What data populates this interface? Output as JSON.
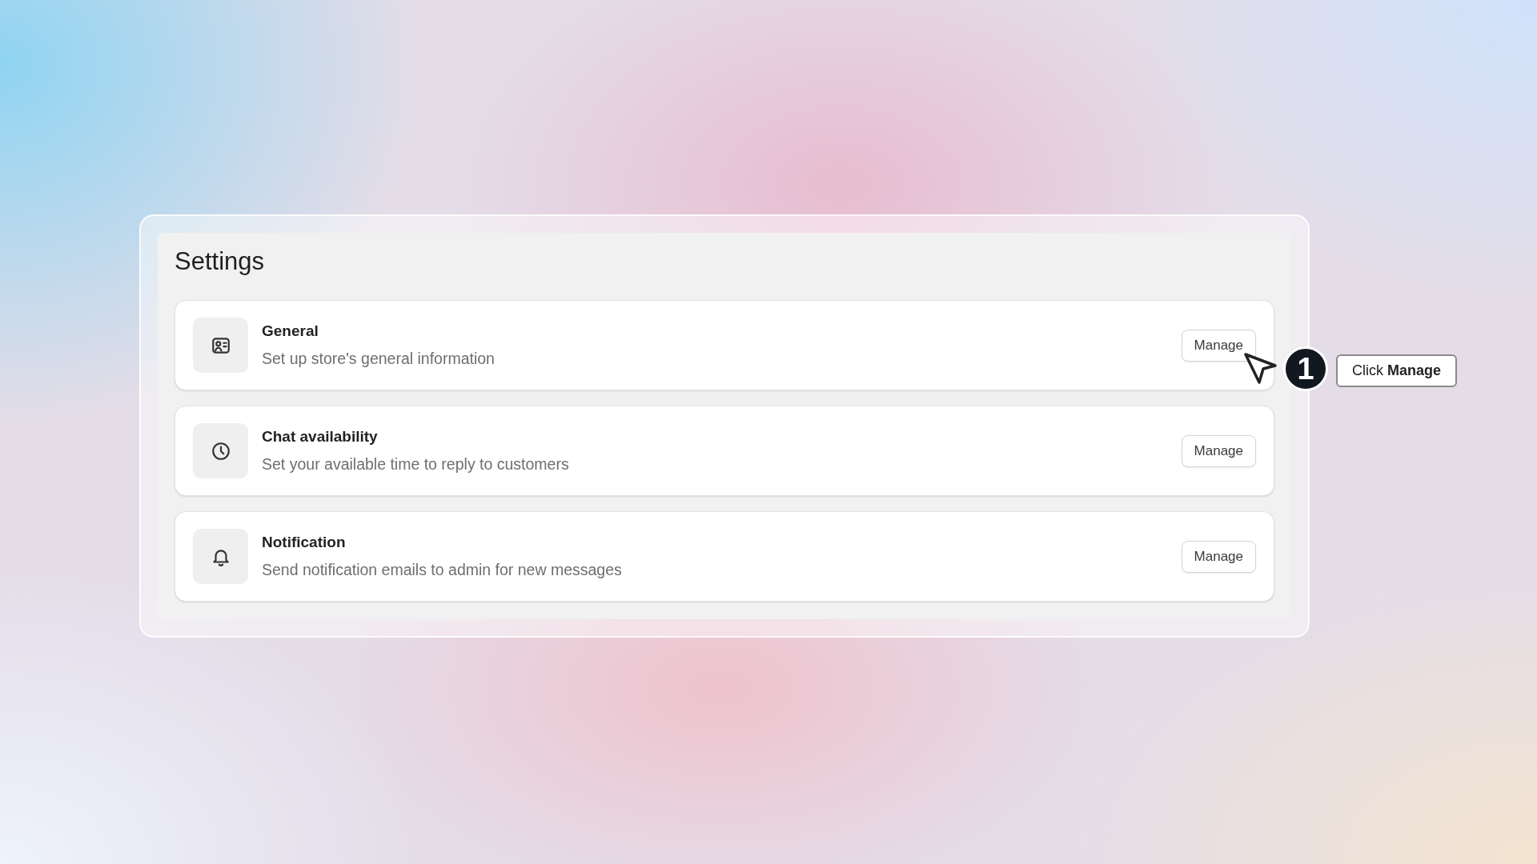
{
  "title": "Settings",
  "items": [
    {
      "kind": "id-card",
      "name": "General",
      "description": "Set up store's general information",
      "button": "Manage"
    },
    {
      "kind": "clock",
      "name": "Chat availability",
      "description": "Set your available time to reply to customers",
      "button": "Manage"
    },
    {
      "kind": "bell",
      "name": "Notification",
      "description": "Send notification emails to admin for new messages",
      "button": "Manage"
    }
  ],
  "callout": {
    "step": "1",
    "text": "Click **Manage**"
  }
}
